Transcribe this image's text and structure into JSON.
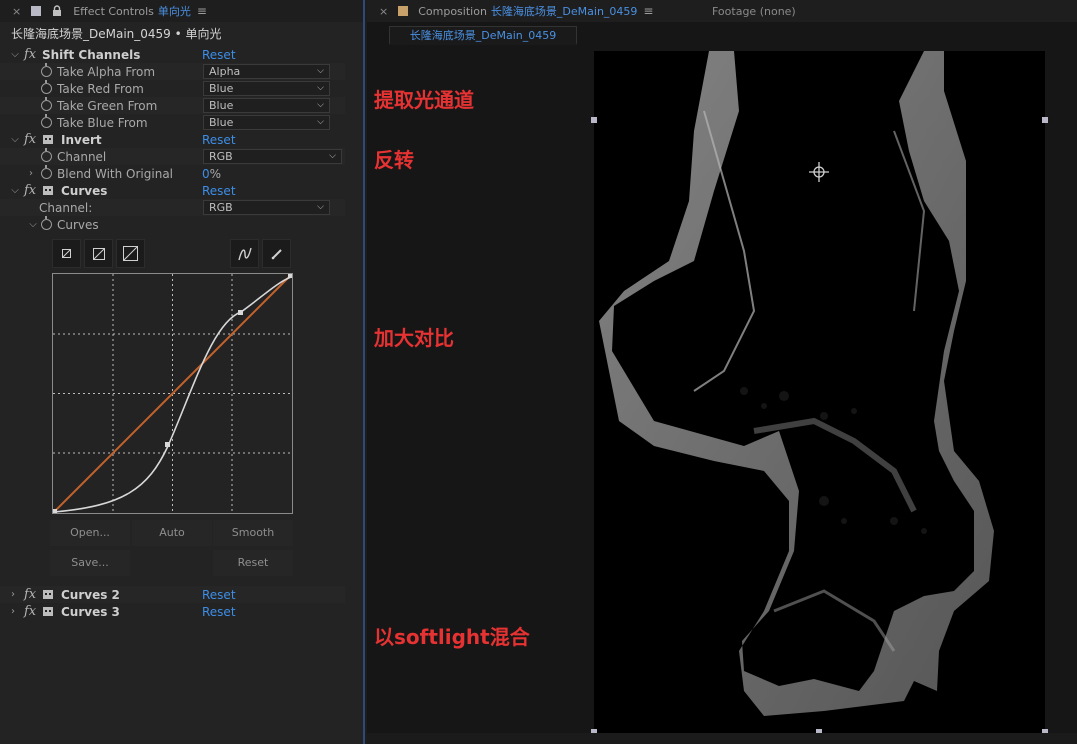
{
  "effect_panel": {
    "tab_close": "×",
    "tab_title": "Effect Controls",
    "tab_layer": "单向光",
    "menu": "≡",
    "layer_path": "长隆海底场景_DeMain_0459 • 单向光"
  },
  "effects": {
    "shift": {
      "name": "Shift Channels",
      "reset": "Reset",
      "params": [
        {
          "label": "Take Alpha From",
          "value": "Alpha"
        },
        {
          "label": "Take Red From",
          "value": "Blue"
        },
        {
          "label": "Take Green From",
          "value": "Blue"
        },
        {
          "label": "Take Blue From",
          "value": "Blue"
        }
      ]
    },
    "invert": {
      "name": "Invert",
      "reset": "Reset",
      "channel_label": "Channel",
      "channel_value": "RGB",
      "blend_label": "Blend With Original",
      "blend_value": "0",
      "blend_unit": "%"
    },
    "curves": {
      "name": "Curves",
      "reset": "Reset",
      "channel_label": "Channel:",
      "channel_value": "RGB",
      "curves_label": "Curves",
      "buttons": {
        "open": "Open...",
        "auto": "Auto",
        "smooth": "Smooth",
        "save": "Save...",
        "reset": "Reset"
      }
    },
    "curves2": {
      "name": "Curves 2",
      "reset": "Reset"
    },
    "curves3": {
      "name": "Curves 3",
      "reset": "Reset"
    }
  },
  "comp_panel": {
    "tab_close": "×",
    "tab_label": "Composition",
    "tab_name": "长隆海底场景_DeMain_0459",
    "menu": "≡",
    "footage": "Footage (none)",
    "subtab": "长隆海底场景_DeMain_0459"
  },
  "annotations": {
    "a1": "提取光通道",
    "a2": "反转",
    "a3": "加大对比",
    "a4": "以softlight混合"
  },
  "colors": {
    "accent_blue": "#3d8ee8",
    "annotation_red": "#e63232",
    "curve_orange": "#c4622d"
  }
}
